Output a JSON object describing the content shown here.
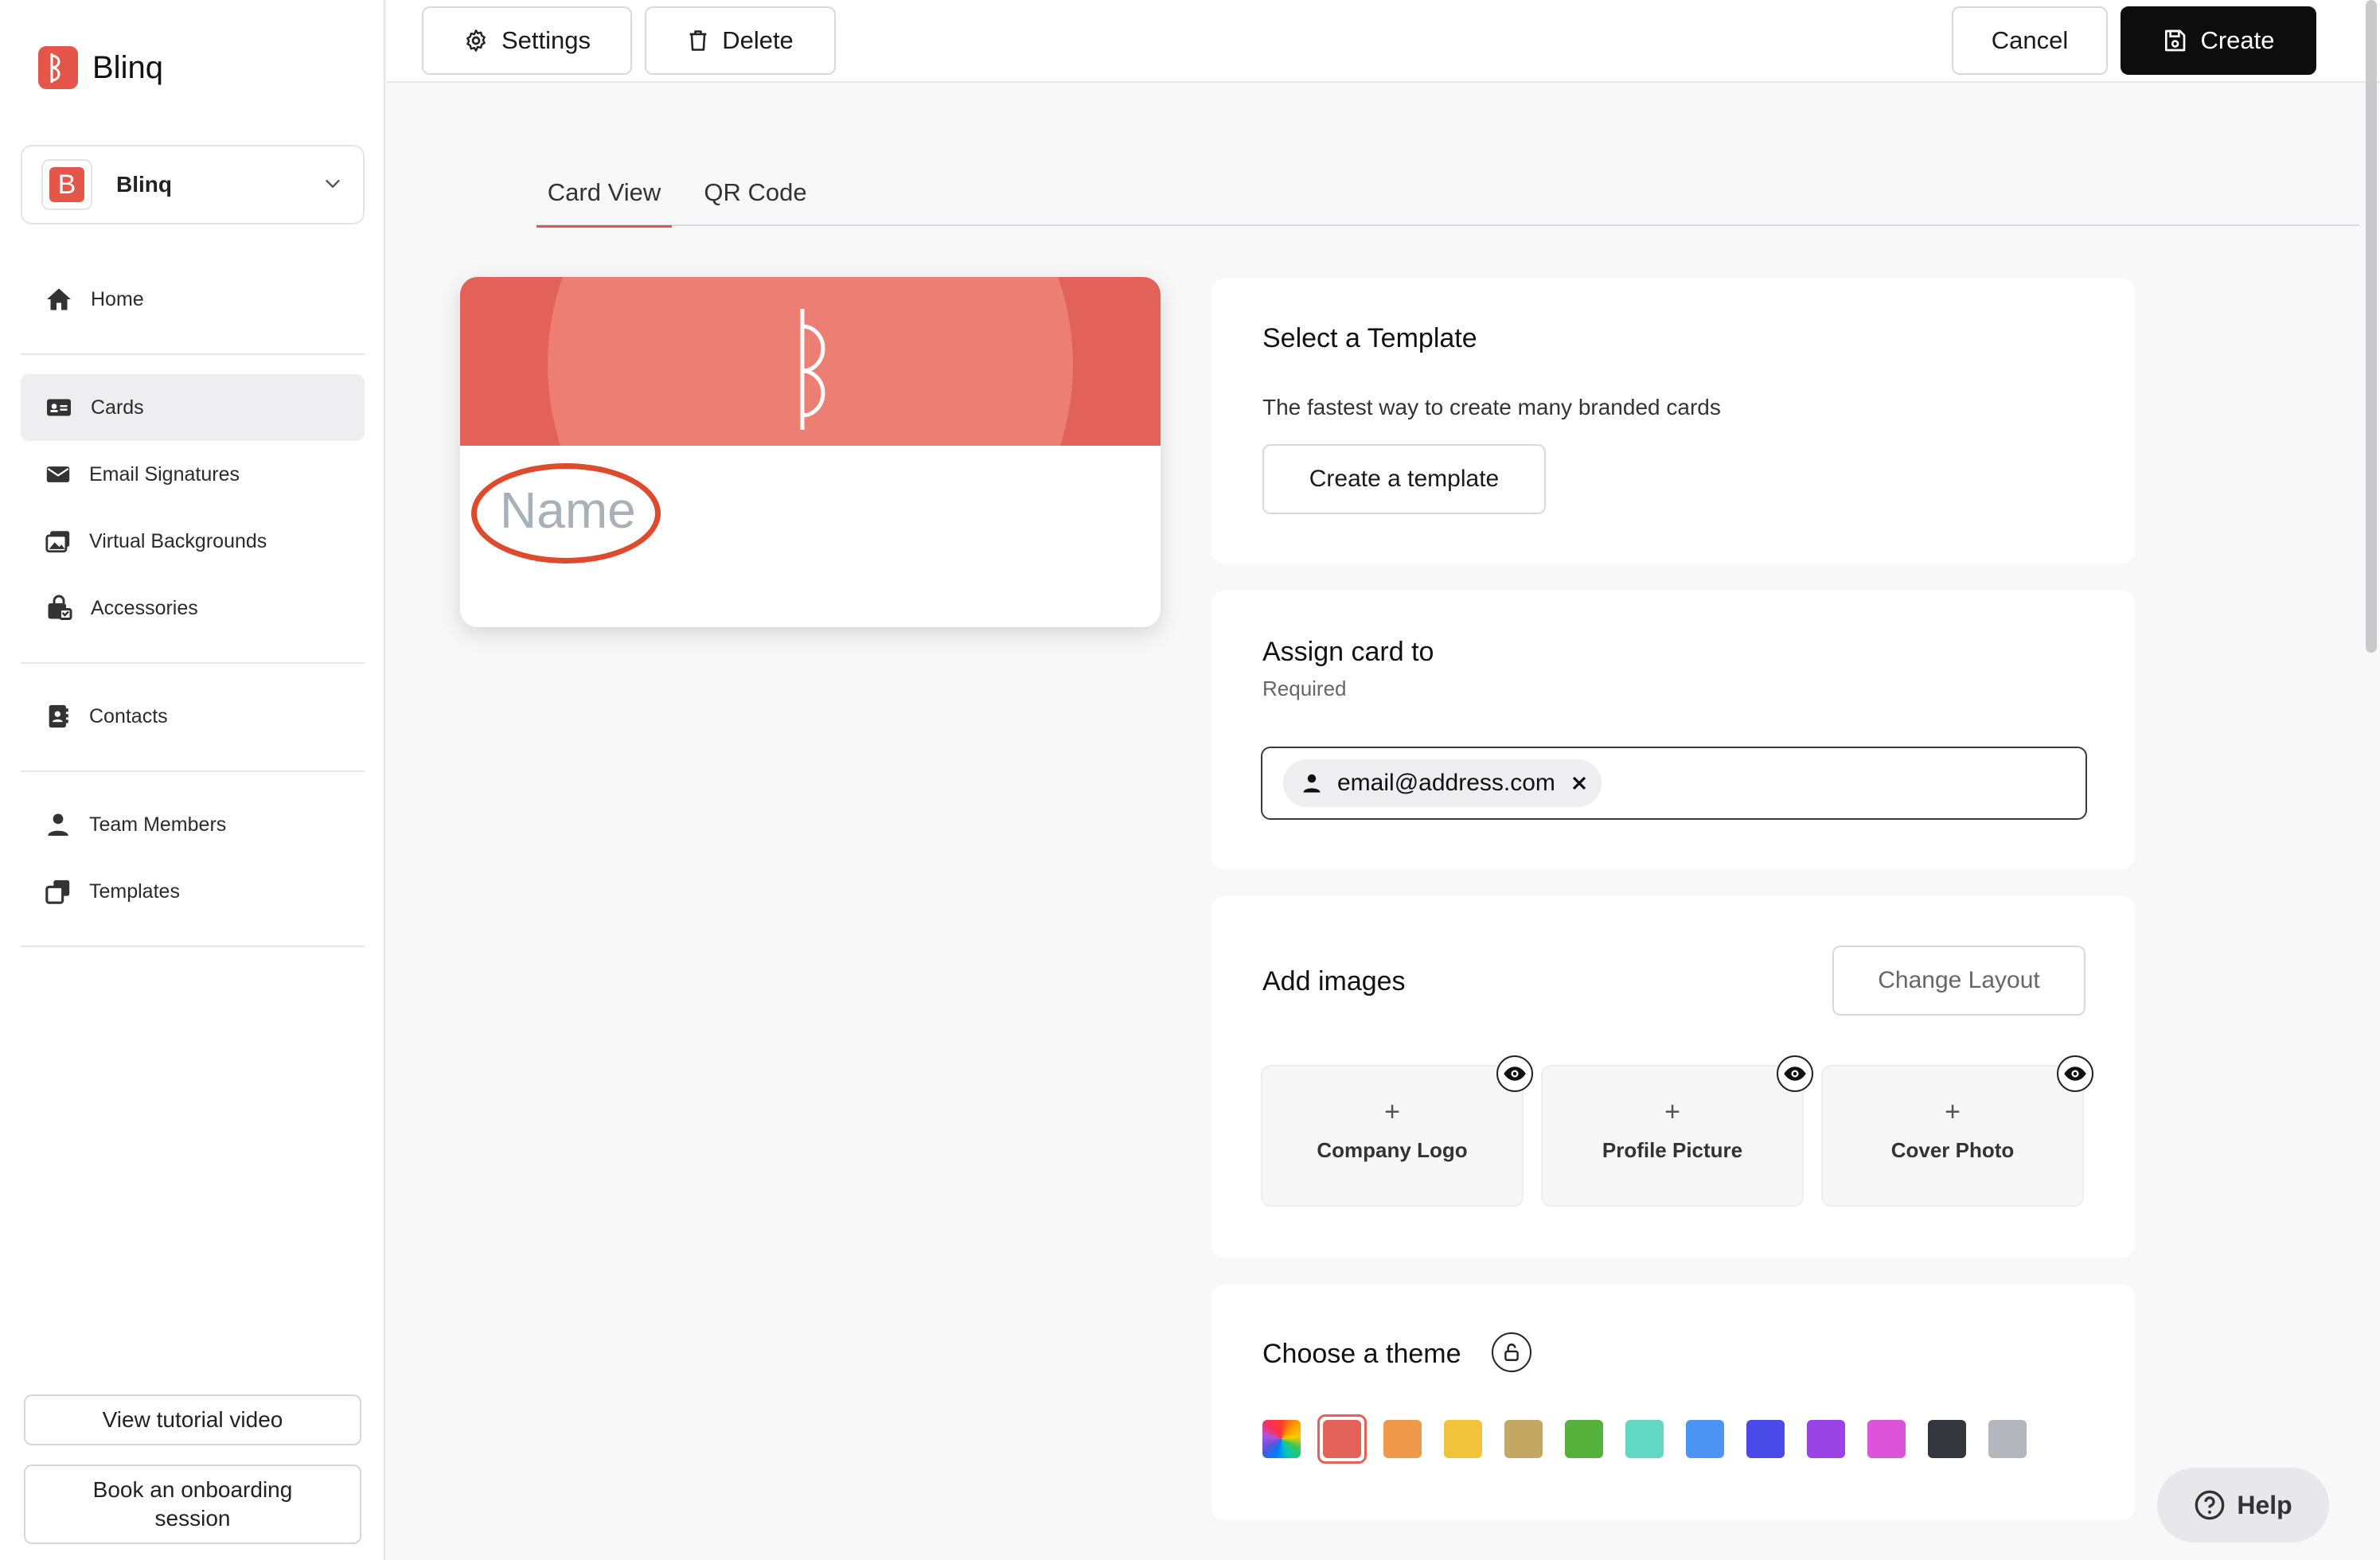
{
  "app": {
    "name": "Blinq"
  },
  "workspace": {
    "name": "Blinq",
    "badge": "B"
  },
  "sidebar": {
    "items": [
      {
        "label": "Home",
        "icon": "home-icon"
      },
      {
        "label": "Cards",
        "icon": "id-card-icon",
        "active": true
      },
      {
        "label": "Email Signatures",
        "icon": "envelope-icon"
      },
      {
        "label": "Virtual Backgrounds",
        "icon": "images-icon"
      },
      {
        "label": "Accessories",
        "icon": "shopping-bag-icon"
      },
      {
        "label": "Contacts",
        "icon": "address-book-icon"
      },
      {
        "label": "Team Members",
        "icon": "user-icon"
      },
      {
        "label": "Templates",
        "icon": "copy-icon"
      }
    ],
    "tutorial_label": "View tutorial video",
    "onboarding_label": "Book an onboarding session"
  },
  "toolbar": {
    "settings_label": "Settings",
    "delete_label": "Delete",
    "cancel_label": "Cancel",
    "create_label": "Create"
  },
  "tabs": [
    {
      "label": "Card View",
      "active": true
    },
    {
      "label": "QR Code",
      "active": false
    }
  ],
  "card_preview": {
    "name_placeholder": "Name",
    "header_color": "#e2625a"
  },
  "template_panel": {
    "title": "Select a Template",
    "subtitle": "The fastest way to create many branded cards",
    "button_label": "Create a template"
  },
  "assign_panel": {
    "title": "Assign card to",
    "required_label": "Required",
    "chip_email": "email@address.com"
  },
  "images_panel": {
    "title": "Add images",
    "change_layout_label": "Change Layout",
    "plus": "+",
    "slots": [
      "Company Logo",
      "Profile Picture",
      "Cover Photo"
    ]
  },
  "theme_panel": {
    "title": "Choose a theme",
    "swatches": [
      "rainbow",
      "#e2625a",
      "#ef9a4a",
      "#f1c23c",
      "#c4a862",
      "#56b13c",
      "#62d7c2",
      "#4d95f5",
      "#4a4ae8",
      "#9a44e6",
      "#dc54d7",
      "#33363a",
      "#b3b7bc"
    ],
    "selected": 1
  },
  "help": {
    "label": "Help"
  }
}
